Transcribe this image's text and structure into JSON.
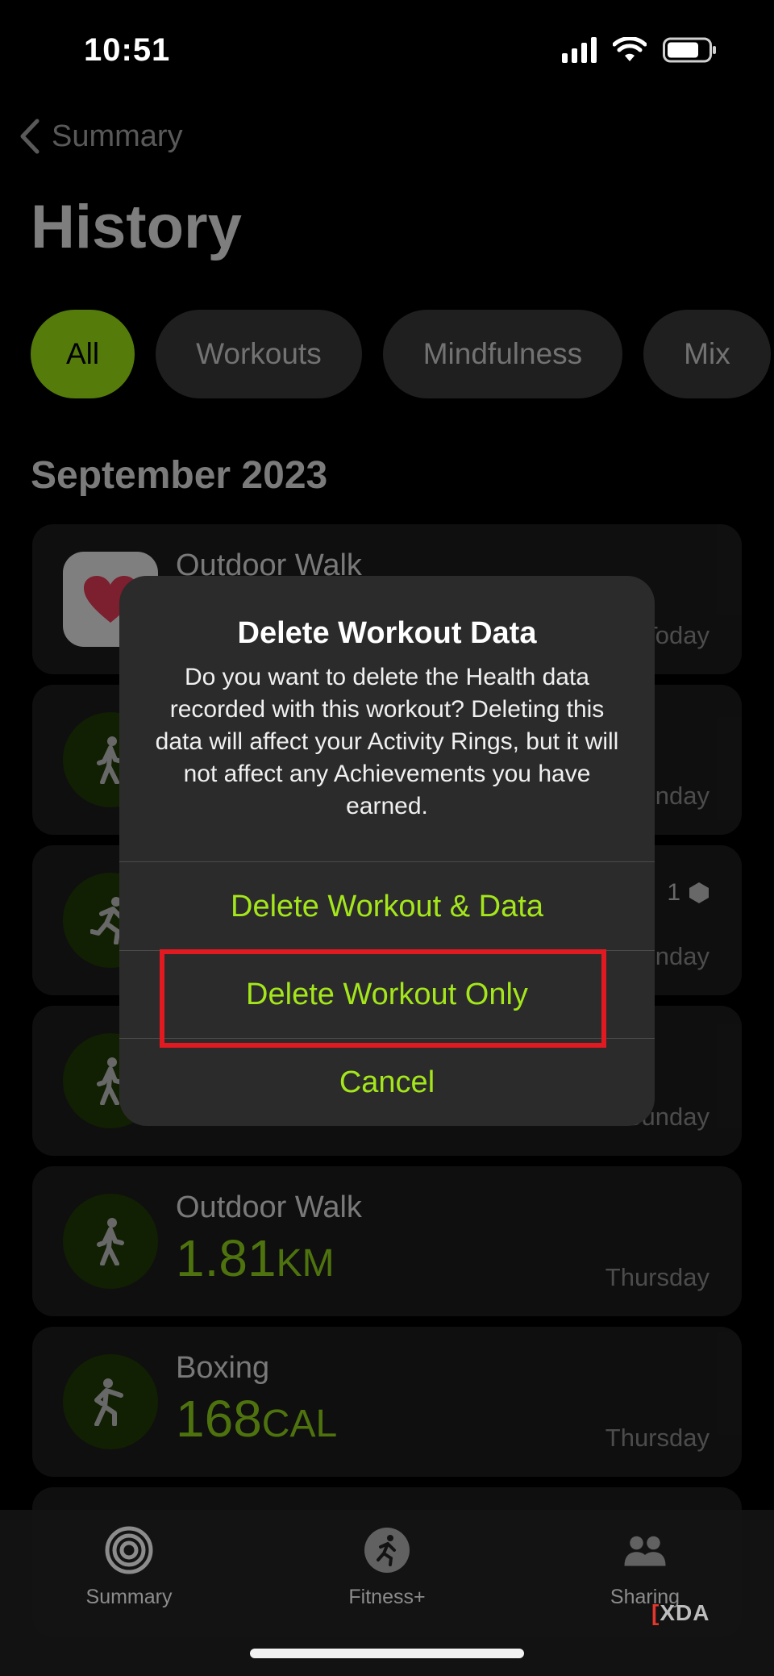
{
  "status_bar": {
    "time": "10:51"
  },
  "nav": {
    "back_label": "Summary",
    "title": "History"
  },
  "filters": [
    {
      "label": "All",
      "active": true
    },
    {
      "label": "Workouts",
      "active": false
    },
    {
      "label": "Mindfulness",
      "active": false
    },
    {
      "label": "Mix",
      "active": false
    }
  ],
  "section": {
    "title": "September 2023"
  },
  "cards": [
    {
      "title": "Outdoor Walk",
      "metric": "",
      "unit": "",
      "day": "Today",
      "icon": "heart-icon"
    },
    {
      "title": "",
      "metric": "",
      "unit": "",
      "day": "Sunday",
      "icon": "walking-figure-icon"
    },
    {
      "title": "",
      "metric": "",
      "unit": "",
      "day": "Sunday",
      "icon": "running-figure-icon",
      "badge": "1"
    },
    {
      "title": "",
      "metric": "",
      "unit": "",
      "day": "Sunday",
      "icon": "walking-figure-icon"
    },
    {
      "title": "Outdoor Walk",
      "metric": "1.81",
      "unit": "KM",
      "day": "Thursday",
      "icon": "walking-figure-icon"
    },
    {
      "title": "Boxing",
      "metric": "168",
      "unit": "CAL",
      "day": "Thursday",
      "icon": "boxing-figure-icon"
    }
  ],
  "alert": {
    "title": "Delete Workout Data",
    "message": "Do you want to delete the Health data recorded with this workout? Deleting this data will affect your Activity Rings, but it will not affect any Achievements you have earned.",
    "buttons": {
      "delete_all": "Delete Workout & Data",
      "delete_only": "Delete Workout Only",
      "cancel": "Cancel"
    }
  },
  "tab_bar": {
    "summary": "Summary",
    "fitness": "Fitness+",
    "sharing": "Sharing"
  },
  "watermark": {
    "bracket": "[",
    "text": "XDA"
  },
  "colors": {
    "accent": "#a4e61b",
    "chip_active": "#9be015",
    "highlight": "#e11a22"
  }
}
